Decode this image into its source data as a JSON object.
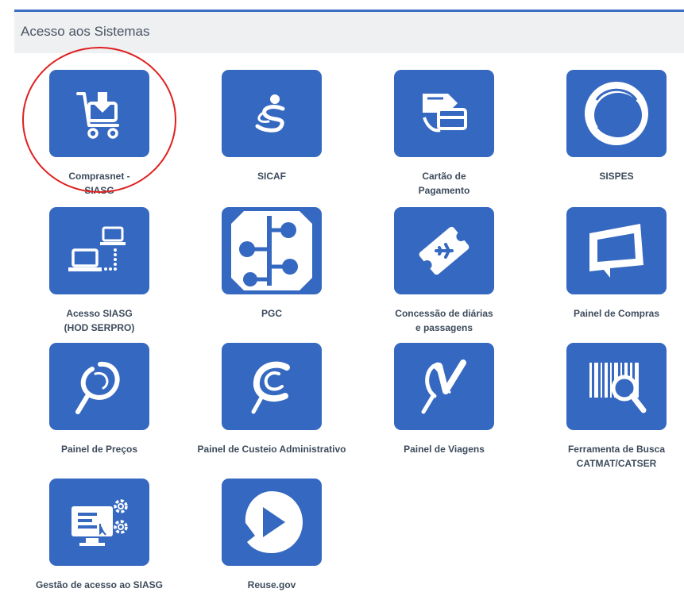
{
  "header": {
    "title": "Acesso aos Sistemas"
  },
  "systems": [
    {
      "name": "comprasnet",
      "label": "Comprasnet -\nSIASG",
      "icon": "shopping-cart-icon"
    },
    {
      "name": "sicaf",
      "label": "SICAF",
      "icon": "sicaf-logo-icon"
    },
    {
      "name": "cartao-pagamento",
      "label": "Cartão de\nPagamento",
      "icon": "payment-card-icon"
    },
    {
      "name": "sispes",
      "label": "SISPES",
      "icon": "sispes-ring-icon"
    },
    {
      "name": "acesso-siasg",
      "label": "Acesso SIASG\n(HOD SERPRO)",
      "icon": "network-computers-icon"
    },
    {
      "name": "pgc",
      "label": "PGC",
      "icon": "tree-nodes-icon"
    },
    {
      "name": "diarias-passagens",
      "label": "Concessão de diárias\ne passagens",
      "icon": "airplane-ticket-icon"
    },
    {
      "name": "painel-compras",
      "label": "Painel de Compras",
      "icon": "panel-frame-icon"
    },
    {
      "name": "painel-precos",
      "label": "Painel de Preços",
      "icon": "magnifier-swirl-icon"
    },
    {
      "name": "painel-custeio",
      "label": "Painel de Custeio Administrativo",
      "icon": "c-swirl-icon"
    },
    {
      "name": "painel-viagens",
      "label": "Painel de Viagens",
      "icon": "v-swirl-icon"
    },
    {
      "name": "busca-catmat",
      "label": "Ferramenta de Busca\nCATMAT/CATSER",
      "icon": "barcode-search-icon"
    },
    {
      "name": "gestao-acesso",
      "label": "Gestão de acesso ao SIASG",
      "icon": "monitor-gears-icon"
    },
    {
      "name": "reuse-gov",
      "label": "Reuse.gov",
      "icon": "play-circle-icon"
    }
  ],
  "colors": {
    "accent": "#3568c0",
    "highlight": "#e02020",
    "header_bg": "#eef0f2"
  }
}
